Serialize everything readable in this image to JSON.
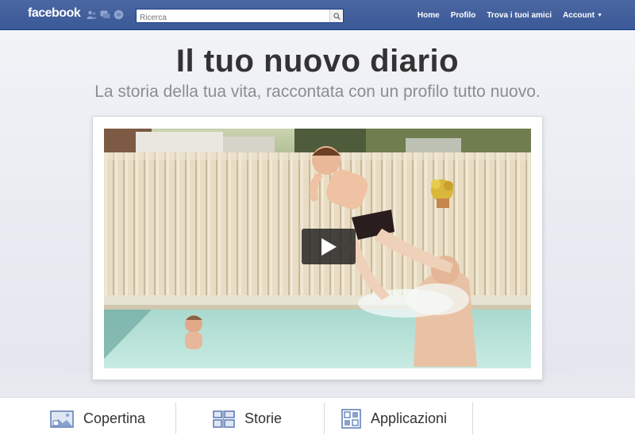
{
  "topbar": {
    "logo": "facebook",
    "search_placeholder": "Ricerca",
    "nav": [
      {
        "label": "Home"
      },
      {
        "label": "Profilo"
      },
      {
        "label": "Trova i tuoi amici"
      },
      {
        "label": "Account"
      }
    ],
    "jewel_icons": [
      "friend-requests-icon",
      "messages-icon",
      "notifications-icon"
    ]
  },
  "hero": {
    "title": "Il tuo nuovo diario",
    "subtitle": "La storia della tua vita, raccontata con un profilo tutto nuovo."
  },
  "video": {
    "play_icon": "play-icon"
  },
  "features": [
    {
      "label": "Copertina",
      "icon": "cover-photo-icon"
    },
    {
      "label": "Storie",
      "icon": "stories-icon"
    },
    {
      "label": "Applicazioni",
      "icon": "apps-icon"
    }
  ],
  "colors": {
    "brand_blue": "#3b5998",
    "icon_blue": "#5b79b4",
    "text_dark": "#333333",
    "text_gray": "#8a8d92"
  }
}
